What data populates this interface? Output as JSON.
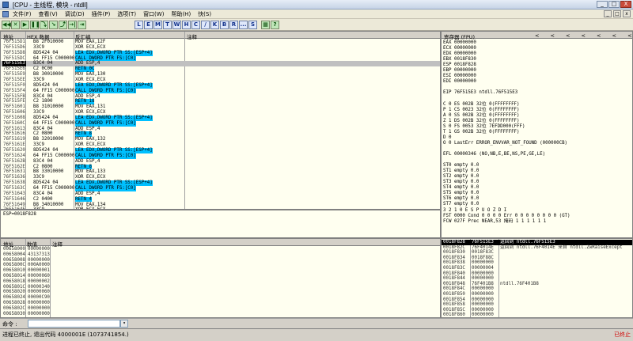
{
  "window": {
    "title": "[CPU - 主线程, 模块 - ntdll]",
    "min": "_",
    "max": "□",
    "close": "X"
  },
  "menu": [
    "文件(F)",
    "查看(V)",
    "调试(D)",
    "插件(P)",
    "选项(T)",
    "窗口(W)",
    "帮助(H)",
    "快(S)"
  ],
  "toolbar": {
    "run_buttons": [
      "◀◀",
      "✕",
      "▶",
      "❚❚",
      "⤵",
      "↘",
      "⤴",
      "→|",
      "⇥"
    ],
    "view_buttons": [
      "L",
      "E",
      "M",
      "T",
      "W",
      "H",
      "C",
      "/",
      "K",
      "B",
      "R",
      "...",
      "S"
    ],
    "extra_buttons": [
      "▦",
      "?"
    ]
  },
  "disasm": {
    "headers": [
      "地址",
      "HEX 数据",
      "反汇编",
      "注释"
    ],
    "rows": [
      {
        "a": "76F515D1",
        "h": "B8 2F010000",
        "d": "MOV EAX,12F"
      },
      {
        "a": "76F515D6",
        "h": "33C9",
        "d": "XOR ECX,ECX"
      },
      {
        "a": "76F515D8",
        "h": "8D5424 04",
        "d": "LEA EDX,DWORD PTR SS:[ESP+4]",
        "hl": true
      },
      {
        "a": "76F515DC",
        "h": "64 FF15 C000000",
        "d": "CALL DWORD PTR FS:[C0]",
        "hl": true
      },
      {
        "a": "76F515E3",
        "h": "83C4 04",
        "d": "ADD ESP,4",
        "sel": true
      },
      {
        "a": "76F515E6",
        "h": "C2 0C00",
        "d": "RETN 0C",
        "hl": true
      },
      {
        "a": "76F515E9",
        "h": "B8 30010000",
        "d": "MOV EAX,130"
      },
      {
        "a": "76F515EE",
        "h": "33C9",
        "d": "XOR ECX,ECX"
      },
      {
        "a": "76F515F0",
        "h": "8D5424 04",
        "d": "LEA EDX,DWORD PTR SS:[ESP+4]",
        "hl": true
      },
      {
        "a": "76F515F4",
        "h": "64 FF15 C000000",
        "d": "CALL DWORD PTR FS:[C0]",
        "hl": true
      },
      {
        "a": "76F515FB",
        "h": "83C4 04",
        "d": "ADD ESP,4"
      },
      {
        "a": "76F515FE",
        "h": "C2 1800",
        "d": "RETN 18",
        "hl": true
      },
      {
        "a": "76F51601",
        "h": "B8 31010000",
        "d": "MOV EAX,131"
      },
      {
        "a": "76F51606",
        "h": "33C9",
        "d": "XOR ECX,ECX"
      },
      {
        "a": "76F51608",
        "h": "8D5424 04",
        "d": "LEA EDX,DWORD PTR SS:[ESP+4]",
        "hl": true
      },
      {
        "a": "76F5160C",
        "h": "64 FF15 C000000",
        "d": "CALL DWORD PTR FS:[C0]",
        "hl": true
      },
      {
        "a": "76F51613",
        "h": "83C4 04",
        "d": "ADD ESP,4"
      },
      {
        "a": "76F51616",
        "h": "C2 0800",
        "d": "RETN 8",
        "hl": true
      },
      {
        "a": "76F51619",
        "h": "B8 32010000",
        "d": "MOV EAX,132"
      },
      {
        "a": "76F5161E",
        "h": "33C9",
        "d": "XOR ECX,ECX"
      },
      {
        "a": "76F51620",
        "h": "8D5424 04",
        "d": "LEA EDX,DWORD PTR SS:[ESP+4]",
        "hl": true
      },
      {
        "a": "76F51624",
        "h": "64 FF15 C000000",
        "d": "CALL DWORD PTR FS:[C0]",
        "hl": true
      },
      {
        "a": "76F5162B",
        "h": "83C4 04",
        "d": "ADD ESP,4"
      },
      {
        "a": "76F5162E",
        "h": "C2 0800",
        "d": "RETN 8",
        "hl": true
      },
      {
        "a": "76F51631",
        "h": "B8 33010000",
        "d": "MOV EAX,133"
      },
      {
        "a": "76F51636",
        "h": "33C9",
        "d": "XOR ECX,ECX"
      },
      {
        "a": "76F51638",
        "h": "8D5424 04",
        "d": "LEA EDX,DWORD PTR SS:[ESP+4]",
        "hl": true
      },
      {
        "a": "76F5163C",
        "h": "64 FF15 C000000",
        "d": "CALL DWORD PTR FS:[C0]",
        "hl": true
      },
      {
        "a": "76F51643",
        "h": "83C4 04",
        "d": "ADD ESP,4"
      },
      {
        "a": "76F51646",
        "h": "C2 0400",
        "d": "RETN 4",
        "hl": true
      },
      {
        "a": "76F51649",
        "h": "B8 34010000",
        "d": "MOV EAX,134"
      },
      {
        "a": "76F5164E",
        "h": "33C9",
        "d": "XOR ECX,ECX"
      }
    ],
    "info": "ESP=0018F828"
  },
  "registers": {
    "header": "寄存器 (FPU)",
    "nav": "< < < < < < < <",
    "lines": [
      "EAX 00000000",
      "ECX 00000000",
      "EDX 00000000",
      "EBX 0018F830",
      "ESP 0018F828",
      "EBP 00000000",
      "ESI 00000000",
      "EDI 00000000",
      "",
      "EIP 76F515E3 ntdll.76F515E3",
      "",
      "C 0  ES 002B 32位 0(FFFFFFFF)",
      "P 1  CS 0023 32位 0(FFFFFFFF)",
      "A 0  SS 002B 32位 0(FFFFFFFF)",
      "Z 1  DS 002B 32位 0(FFFFFFFF)",
      "S 0  FS 0053 32位 7EFDD000(FFF)",
      "T 1  GS 002B 32位 0(FFFFFFFF)",
      "D 0",
      "O 0  LastErr ERROR_ENVVAR_NOT_FOUND (000000CB)",
      "",
      "EFL 00000346 (NO,NB,E,BE,NS,PE,GE,LE)",
      "",
      "ST0 empty 0.0",
      "ST1 empty 0.0",
      "ST2 empty 0.0",
      "ST3 empty 0.0",
      "ST4 empty 0.0",
      "ST5 empty 0.0",
      "ST6 empty 0.0",
      "ST7 empty 0.0",
      "               3 2 1 0      E S P U O Z D I",
      "FST 0000  Cond 0 0 0 0  Err 0 0 0 0 0 0 0 0  (GT)",
      "FCW 027F  Prec NEAR,53  掩码    1 1 1 1 1 1"
    ]
  },
  "dump": {
    "headers": [
      "地址",
      "数值",
      "注释"
    ],
    "rows": [
      {
        "a": "00658000",
        "v": "00000000"
      },
      {
        "a": "00658004",
        "v": "43137313"
      },
      {
        "a": "00658008",
        "v": "00000000"
      },
      {
        "a": "0065800C",
        "v": "000A0000"
      },
      {
        "a": "00658010",
        "v": "00000001"
      },
      {
        "a": "00658014",
        "v": "00000060"
      },
      {
        "a": "00658018",
        "v": "00000002"
      },
      {
        "a": "0065801C",
        "v": "00000340"
      },
      {
        "a": "00658020",
        "v": "00000060"
      },
      {
        "a": "00658024",
        "v": "00000C90"
      },
      {
        "a": "00658028",
        "v": "00000000"
      },
      {
        "a": "0065802C",
        "v": "00000000"
      },
      {
        "a": "00658030",
        "v": "00000000"
      }
    ]
  },
  "stack": {
    "rows": [
      {
        "a": "0018F828",
        "v": "76F515E3",
        "c": "返回到 ntdll.76F515E3",
        "sel": true
      },
      {
        "a": "0018F82C",
        "v": "76F4014E",
        "c": "返回到 ntdll.76F4014E 来自 ntdll.ZwRaiseExcept"
      },
      {
        "a": "0018F830",
        "v": "0018F83C",
        "c": ""
      },
      {
        "a": "0018F834",
        "v": "0018F88C",
        "c": ""
      },
      {
        "a": "0018F838",
        "v": "00000000",
        "c": ""
      },
      {
        "a": "0018F83C",
        "v": "00000004",
        "c": ""
      },
      {
        "a": "0018F840",
        "v": "00000000",
        "c": ""
      },
      {
        "a": "0018F844",
        "v": "00000000",
        "c": ""
      },
      {
        "a": "0018F848",
        "v": "76F401B8",
        "c": "ntdll.76F401B8"
      },
      {
        "a": "0018F84C",
        "v": "00000000",
        "c": ""
      },
      {
        "a": "0018F850",
        "v": "00000000",
        "c": ""
      },
      {
        "a": "0018F854",
        "v": "00000000",
        "c": ""
      },
      {
        "a": "0018F858",
        "v": "00000000",
        "c": ""
      },
      {
        "a": "0018F85C",
        "v": "00000000",
        "c": ""
      },
      {
        "a": "0018F860",
        "v": "00000000",
        "c": ""
      }
    ]
  },
  "command": {
    "label": "命令 :"
  },
  "status": {
    "text": "进程已终止, 退出代码 4000001E (1073741854.)",
    "state": "已终止"
  }
}
